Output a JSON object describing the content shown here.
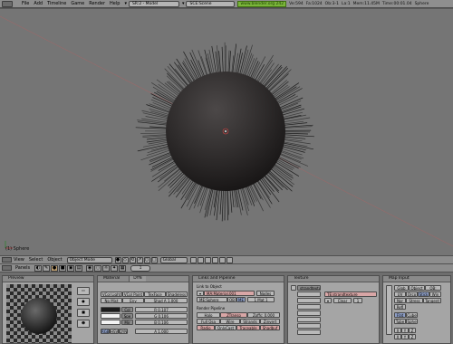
{
  "topbar": {
    "menus": [
      "File",
      "Add",
      "Timeline",
      "Game",
      "Render",
      "Help"
    ],
    "screen": "SR:2 - Model",
    "scene": "SCE:Scene",
    "url": "www.blender.org 242",
    "stats": [
      "Ve:594",
      "Fa:1024",
      "Ob:3-1",
      "La:1",
      "Mem:11.45M",
      "Time:00:01.04",
      "Sphere"
    ]
  },
  "viewport": {
    "object_label": "(1) Sphere"
  },
  "view3d_header": {
    "menus": [
      "View",
      "Select",
      "Object"
    ],
    "mode": "Object Mode",
    "orientation": "Global"
  },
  "buttons_header": {
    "panels_label": "Panels",
    "frame": "1"
  },
  "preview_panel": {
    "title": "Preview"
  },
  "material_panel": {
    "tab_material": "Material",
    "tab_dyn": "DYN",
    "buttons": [
      "VCol Light",
      "VCol Paint",
      "TexFace",
      "Shadeless",
      "No Mist",
      "Env",
      "Shad A 1.000"
    ],
    "color_rows": [
      {
        "name": "Col",
        "value": "R 0.107"
      },
      {
        "name": "Spe",
        "value": "G 0.106"
      },
      {
        "name": "Mir",
        "value": "B 0.106"
      }
    ],
    "color_modes": [
      "RGB",
      "HSV",
      "DYN"
    ],
    "alpha": "A 1.000"
  },
  "links_panel": {
    "tabs": [
      "Links and Pipeline"
    ],
    "link_label": "Link to Object",
    "material_name": "MA:Material.001",
    "me_name": "ME:Sphere",
    "ob_btn": "OB",
    "me_btn": "ME",
    "mat_count": "1 Mat 1",
    "nodes_btn": "Nodes",
    "render_pipeline": "Render Pipeline",
    "pipeline_buttons": [
      "Halo",
      "ZTransp",
      "Zoffs: 0.000",
      "Full Osa",
      "Wire",
      "Strands",
      "Zinvert",
      "Radio",
      "OnlyCast",
      "Traceable",
      "Shadbuf"
    ]
  },
  "texture_panel": {
    "title": "Texture",
    "slot_name": "strandtexture",
    "te_name": "TE:strandtexture",
    "clear_btn": "Clear",
    "count": "1"
  },
  "map_input_panel": {
    "title": "Map Input",
    "buttons": [
      "Glob",
      "Object",
      "OB:",
      "UV",
      "Orco",
      "Stick",
      "Win",
      "Nor",
      "Stress",
      "Tangent",
      "Refl",
      "Flat",
      "Cube",
      "Tube",
      "Sphe"
    ],
    "xyz": [
      "X",
      "Y",
      "Z"
    ]
  }
}
